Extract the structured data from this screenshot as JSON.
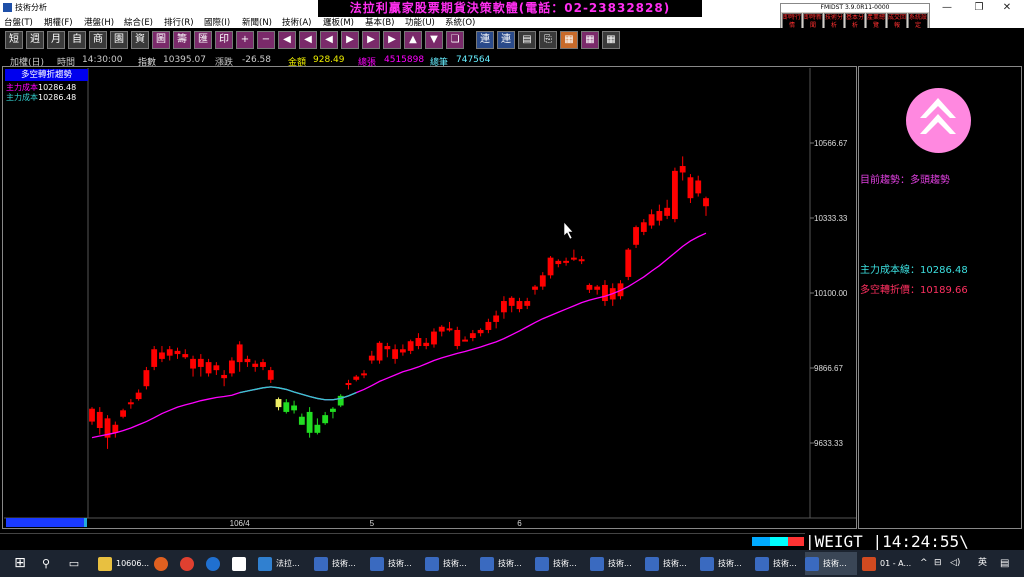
{
  "window": {
    "title": "技術分析",
    "banner": "法拉利贏家股票期貨決策軟體(電話：02-23832828)",
    "controls": [
      "—",
      "❐",
      "✕"
    ]
  },
  "menu": [
    "台盤(T)",
    "期權(F)",
    "港盤(H)",
    "綜合(E)",
    "排行(R)",
    "國際(I)",
    "新聞(N)",
    "技術(A)",
    "邏板(M)",
    "基本(B)",
    "功能(U)",
    "系統(O)"
  ],
  "fmi": {
    "version": "FMIDST 3.9.0R11-0000",
    "buttons": [
      "即時行情",
      "即時新聞",
      "技術分析",
      "基本分析",
      "產業總覽",
      "成交回報",
      "系統設定"
    ]
  },
  "toolbar": [
    "短",
    "週",
    "月",
    "自",
    "商",
    "園",
    "資",
    "圖",
    "籌",
    "匯",
    "印",
    "+",
    "−",
    "◀",
    "◀",
    "◀",
    "▶",
    "▶",
    "▶",
    "▲",
    "▼",
    "❏",
    "連",
    "連",
    "▤",
    "⎘",
    "▦",
    "▦",
    "▦"
  ],
  "status": {
    "instrument": "加權(日)",
    "time_label": "時間",
    "time": "14:30:00",
    "index_label": "指數",
    "index": "10395.07",
    "change_label": "漲跌",
    "change": "-26.58",
    "amount_label": "金額",
    "amount": "928.49",
    "volume_label": "總張",
    "volume": "4515898",
    "trades_label": "總筆",
    "trades": "747564"
  },
  "legend": {
    "title": "多空轉折趨勢",
    "cost_label": "主力成本",
    "cost_magenta": "10286.48",
    "cost_cyan": "10286.48"
  },
  "right_panel": {
    "trend_label": "目前趨勢：多頭趨勢",
    "cost_line_label": "主力成本線：10286.48",
    "turn_price_label": "多空轉折價：10189.66"
  },
  "bottom": {
    "ticker": "WEIGT",
    "clock": "14:24:55"
  },
  "taskbar": {
    "items": [
      "10606...",
      "法拉...",
      "技術...",
      "技術...",
      "技術...",
      "技術...",
      "技術...",
      "技術...",
      "技術...",
      "技術...",
      "技術...",
      "01 - A..."
    ],
    "tray_lang": "英"
  },
  "colors": {
    "up": "#ff0000",
    "down": "#ff0000",
    "green": "#22dd22",
    "yellow": "#eeee66",
    "ma_magenta": "#ff00ff",
    "ma_cyan": "#33cccc",
    "banner": "#ff2ef0"
  },
  "chart_data": {
    "type": "candlestick",
    "y_ticks": [
      "10566.67",
      "10333.33",
      "10100.00",
      "9866.67",
      "9633.33"
    ],
    "x_ticks": [
      "106/4",
      "5",
      "6"
    ],
    "ylim": [
      9570,
      10660
    ],
    "candles": [
      {
        "o": 9700,
        "h": 9745,
        "l": 9690,
        "c": 9740,
        "col": "r"
      },
      {
        "o": 9730,
        "h": 9745,
        "l": 9660,
        "c": 9680,
        "col": "r"
      },
      {
        "o": 9710,
        "h": 9720,
        "l": 9615,
        "c": 9650,
        "col": "r"
      },
      {
        "o": 9665,
        "h": 9700,
        "l": 9650,
        "c": 9690,
        "col": "r"
      },
      {
        "o": 9715,
        "h": 9740,
        "l": 9710,
        "c": 9735,
        "col": "r"
      },
      {
        "o": 9755,
        "h": 9770,
        "l": 9740,
        "c": 9760,
        "col": "r"
      },
      {
        "o": 9770,
        "h": 9800,
        "l": 9765,
        "c": 9790,
        "col": "r"
      },
      {
        "o": 9810,
        "h": 9870,
        "l": 9800,
        "c": 9860,
        "col": "r"
      },
      {
        "o": 9870,
        "h": 9935,
        "l": 9860,
        "c": 9925,
        "col": "r"
      },
      {
        "o": 9915,
        "h": 9935,
        "l": 9885,
        "c": 9895,
        "col": "r"
      },
      {
        "o": 9925,
        "h": 9935,
        "l": 9890,
        "c": 9905,
        "col": "r"
      },
      {
        "o": 9910,
        "h": 9930,
        "l": 9895,
        "c": 9920,
        "col": "r"
      },
      {
        "o": 9910,
        "h": 9925,
        "l": 9895,
        "c": 9900,
        "col": "r"
      },
      {
        "o": 9895,
        "h": 9905,
        "l": 9840,
        "c": 9865,
        "col": "r"
      },
      {
        "o": 9870,
        "h": 9910,
        "l": 9840,
        "c": 9895,
        "col": "r"
      },
      {
        "o": 9885,
        "h": 9895,
        "l": 9840,
        "c": 9850,
        "col": "r"
      },
      {
        "o": 9860,
        "h": 9885,
        "l": 9845,
        "c": 9875,
        "col": "r"
      },
      {
        "o": 9835,
        "h": 9860,
        "l": 9810,
        "c": 9845,
        "col": "r"
      },
      {
        "o": 9850,
        "h": 9900,
        "l": 9840,
        "c": 9890,
        "col": "r"
      },
      {
        "o": 9885,
        "h": 9950,
        "l": 9855,
        "c": 9940,
        "col": "r"
      },
      {
        "o": 9895,
        "h": 9905,
        "l": 9870,
        "c": 9885,
        "col": "r"
      },
      {
        "o": 9880,
        "h": 9890,
        "l": 9855,
        "c": 9870,
        "col": "r"
      },
      {
        "o": 9885,
        "h": 9895,
        "l": 9860,
        "c": 9870,
        "col": "r"
      },
      {
        "o": 9860,
        "h": 9870,
        "l": 9820,
        "c": 9830,
        "col": "r"
      },
      {
        "o": 9770,
        "h": 9775,
        "l": 9735,
        "c": 9745,
        "col": "y"
      },
      {
        "o": 9760,
        "h": 9770,
        "l": 9725,
        "c": 9730,
        "col": "g"
      },
      {
        "o": 9750,
        "h": 9765,
        "l": 9725,
        "c": 9735,
        "col": "g"
      },
      {
        "o": 9715,
        "h": 9725,
        "l": 9690,
        "c": 9690,
        "col": "g"
      },
      {
        "o": 9730,
        "h": 9745,
        "l": 9650,
        "c": 9665,
        "col": "g"
      },
      {
        "o": 9690,
        "h": 9710,
        "l": 9660,
        "c": 9665,
        "col": "g"
      },
      {
        "o": 9720,
        "h": 9730,
        "l": 9690,
        "c": 9695,
        "col": "g"
      },
      {
        "o": 9730,
        "h": 9745,
        "l": 9710,
        "c": 9740,
        "col": "g"
      },
      {
        "o": 9780,
        "h": 9785,
        "l": 9745,
        "c": 9750,
        "col": "g"
      },
      {
        "o": 9820,
        "h": 9830,
        "l": 9800,
        "c": 9815,
        "col": "r"
      },
      {
        "o": 9830,
        "h": 9845,
        "l": 9825,
        "c": 9840,
        "col": "r"
      },
      {
        "o": 9845,
        "h": 9860,
        "l": 9835,
        "c": 9850,
        "col": "r"
      },
      {
        "o": 9890,
        "h": 9920,
        "l": 9880,
        "c": 9905,
        "col": "r"
      },
      {
        "o": 9890,
        "h": 9950,
        "l": 9880,
        "c": 9945,
        "col": "r"
      },
      {
        "o": 9925,
        "h": 9945,
        "l": 9900,
        "c": 9935,
        "col": "r"
      },
      {
        "o": 9895,
        "h": 9940,
        "l": 9880,
        "c": 9925,
        "col": "r"
      },
      {
        "o": 9915,
        "h": 9940,
        "l": 9905,
        "c": 9925,
        "col": "r"
      },
      {
        "o": 9920,
        "h": 9955,
        "l": 9910,
        "c": 9950,
        "col": "r"
      },
      {
        "o": 9935,
        "h": 9975,
        "l": 9925,
        "c": 9960,
        "col": "r"
      },
      {
        "o": 9935,
        "h": 9960,
        "l": 9925,
        "c": 9945,
        "col": "r"
      },
      {
        "o": 9940,
        "h": 9990,
        "l": 9930,
        "c": 9980,
        "col": "r"
      },
      {
        "o": 9980,
        "h": 10000,
        "l": 9965,
        "c": 9995,
        "col": "r"
      },
      {
        "o": 9990,
        "h": 10010,
        "l": 9980,
        "c": 9990,
        "col": "r"
      },
      {
        "o": 9985,
        "h": 9995,
        "l": 9925,
        "c": 9935,
        "col": "r"
      },
      {
        "o": 9955,
        "h": 9965,
        "l": 9950,
        "c": 9955,
        "col": "r"
      },
      {
        "o": 9960,
        "h": 9985,
        "l": 9950,
        "c": 9975,
        "col": "r"
      },
      {
        "o": 9975,
        "h": 9990,
        "l": 9965,
        "c": 9985,
        "col": "r"
      },
      {
        "o": 9985,
        "h": 10020,
        "l": 9975,
        "c": 10010,
        "col": "r"
      },
      {
        "o": 10010,
        "h": 10045,
        "l": 9990,
        "c": 10030,
        "col": "r"
      },
      {
        "o": 10040,
        "h": 10090,
        "l": 10020,
        "c": 10075,
        "col": "r"
      },
      {
        "o": 10060,
        "h": 10090,
        "l": 10040,
        "c": 10085,
        "col": "r"
      },
      {
        "o": 10050,
        "h": 10085,
        "l": 10040,
        "c": 10075,
        "col": "r"
      },
      {
        "o": 10060,
        "h": 10085,
        "l": 10050,
        "c": 10075,
        "col": "r"
      },
      {
        "o": 10110,
        "h": 10125,
        "l": 10095,
        "c": 10120,
        "col": "r"
      },
      {
        "o": 10120,
        "h": 10165,
        "l": 10110,
        "c": 10155,
        "col": "r"
      },
      {
        "o": 10155,
        "h": 10215,
        "l": 10145,
        "c": 10210,
        "col": "r"
      },
      {
        "o": 10190,
        "h": 10205,
        "l": 10180,
        "c": 10200,
        "col": "r"
      },
      {
        "o": 10195,
        "h": 10210,
        "l": 10185,
        "c": 10200,
        "col": "r"
      },
      {
        "o": 10205,
        "h": 10235,
        "l": 10200,
        "c": 10210,
        "col": "r"
      },
      {
        "o": 10205,
        "h": 10215,
        "l": 10190,
        "c": 10205,
        "col": "r"
      },
      {
        "o": 10110,
        "h": 10130,
        "l": 10100,
        "c": 10125,
        "col": "r"
      },
      {
        "o": 10110,
        "h": 10125,
        "l": 10095,
        "c": 10120,
        "col": "r"
      },
      {
        "o": 10125,
        "h": 10140,
        "l": 10060,
        "c": 10075,
        "col": "r"
      },
      {
        "o": 10115,
        "h": 10130,
        "l": 10060,
        "c": 10080,
        "col": "r"
      },
      {
        "o": 10090,
        "h": 10140,
        "l": 10080,
        "c": 10130,
        "col": "r"
      },
      {
        "o": 10150,
        "h": 10240,
        "l": 10140,
        "c": 10235,
        "col": "r"
      },
      {
        "o": 10250,
        "h": 10310,
        "l": 10240,
        "c": 10305,
        "col": "r"
      },
      {
        "o": 10290,
        "h": 10330,
        "l": 10280,
        "c": 10320,
        "col": "r"
      },
      {
        "o": 10310,
        "h": 10360,
        "l": 10300,
        "c": 10345,
        "col": "r"
      },
      {
        "o": 10325,
        "h": 10375,
        "l": 10310,
        "c": 10355,
        "col": "r"
      },
      {
        "o": 10340,
        "h": 10390,
        "l": 10330,
        "c": 10365,
        "col": "r"
      },
      {
        "o": 10330,
        "h": 10490,
        "l": 10320,
        "c": 10480,
        "col": "r"
      },
      {
        "o": 10475,
        "h": 10525,
        "l": 10450,
        "c": 10495,
        "col": "r"
      },
      {
        "o": 10460,
        "h": 10470,
        "l": 10380,
        "c": 10395,
        "col": "r"
      },
      {
        "o": 10450,
        "h": 10465,
        "l": 10400,
        "c": 10410,
        "col": "r"
      },
      {
        "o": 10395,
        "h": 10400,
        "l": 10340,
        "c": 10370,
        "col": "r"
      }
    ],
    "ma": [
      9650,
      9655,
      9660,
      9665,
      9672,
      9680,
      9690,
      9700,
      9712,
      9725,
      9735,
      9745,
      9752,
      9758,
      9765,
      9770,
      9775,
      9778,
      9782,
      9790,
      9795,
      9800,
      9805,
      9808,
      9805,
      9800,
      9792,
      9785,
      9778,
      9772,
      9768,
      9768,
      9772,
      9780,
      9790,
      9800,
      9812,
      9825,
      9835,
      9845,
      9855,
      9862,
      9870,
      9880,
      9890,
      9898,
      9905,
      9912,
      9918,
      9925,
      9932,
      9940,
      9948,
      9958,
      9970,
      9982,
      9995,
      10008,
      10020,
      10030,
      10040,
      10050,
      10060,
      10070,
      10078,
      10084,
      10090,
      10098,
      10108,
      10120,
      10135,
      10150,
      10168,
      10185,
      10205,
      10225,
      10245,
      10262,
      10275,
      10286
    ]
  }
}
